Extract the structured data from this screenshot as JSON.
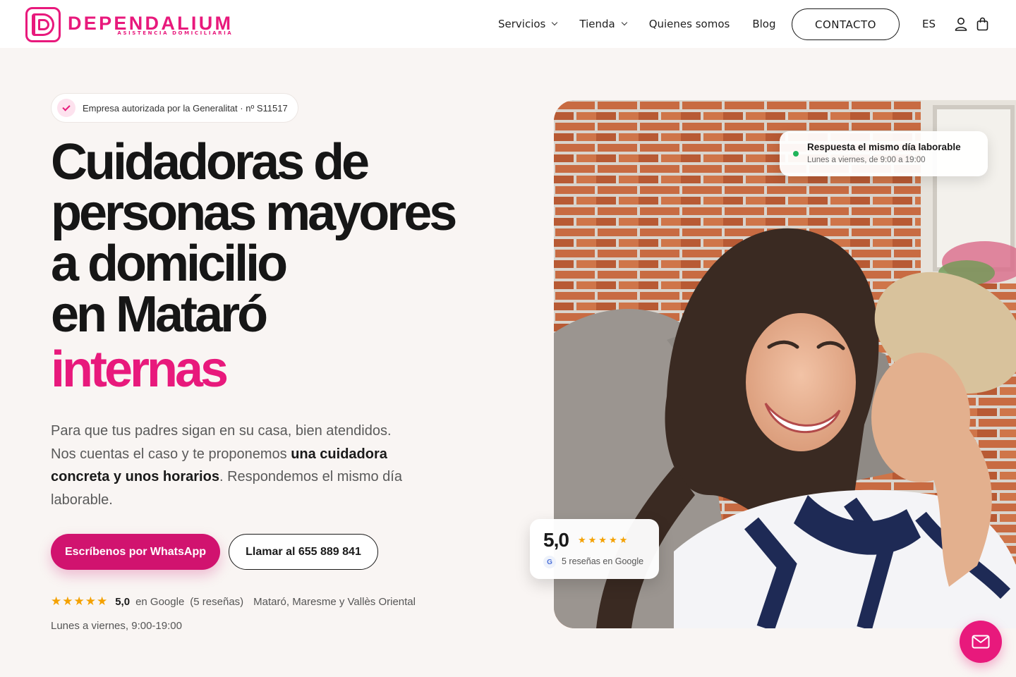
{
  "brand": {
    "name": "DEPENDALIUM",
    "tagline": "ASISTENCIA DOMICILIARIA",
    "accent": "#e8197c"
  },
  "nav": {
    "items": [
      {
        "label": "Servicios",
        "has_dropdown": true
      },
      {
        "label": "Tienda",
        "has_dropdown": true
      },
      {
        "label": "Quienes somos",
        "has_dropdown": false
      },
      {
        "label": "Blog",
        "has_dropdown": false
      }
    ],
    "contact_label": "CONTACTO",
    "language": "ES",
    "icons": [
      "user-icon",
      "shopping-bag-icon"
    ]
  },
  "hero": {
    "badge": "Empresa autorizada por la Generalitat · nº S11517",
    "headline_lines": [
      "Cuidadoras de",
      "personas mayores",
      "a domicilio",
      "en Mataró"
    ],
    "headline_highlight": "internas",
    "lead_plain_1": "Para que tus padres sigan en su casa, bien atendidos. Nos cuentas el caso y te proponemos ",
    "lead_bold": "una cuidadora concreta y unos horarios",
    "lead_plain_2": ". Respondemos el mismo día laborable.",
    "btn_whatsapp": "Escríbenos por WhatsApp",
    "btn_call": "Llamar al 655 889 841",
    "rating": {
      "stars": "★★★★★",
      "score": "5,0",
      "source": "en Google",
      "count": "(5 reseñas)"
    },
    "region": "Mataró, Maresme y Vallès Oriental",
    "hours": "Lunes a viernes, 9:00-19:00"
  },
  "response_card": {
    "title": "Respuesta el mismo día laborable",
    "subtitle": "Lunes a viernes, de 9:00 a 19:00",
    "status_color": "#1fb45a"
  },
  "review_card": {
    "score": "5,0",
    "stars": "★★★★★",
    "google_letter": "G",
    "text": "5 reseñas en Google"
  },
  "fab": {
    "icon": "mail-icon"
  }
}
